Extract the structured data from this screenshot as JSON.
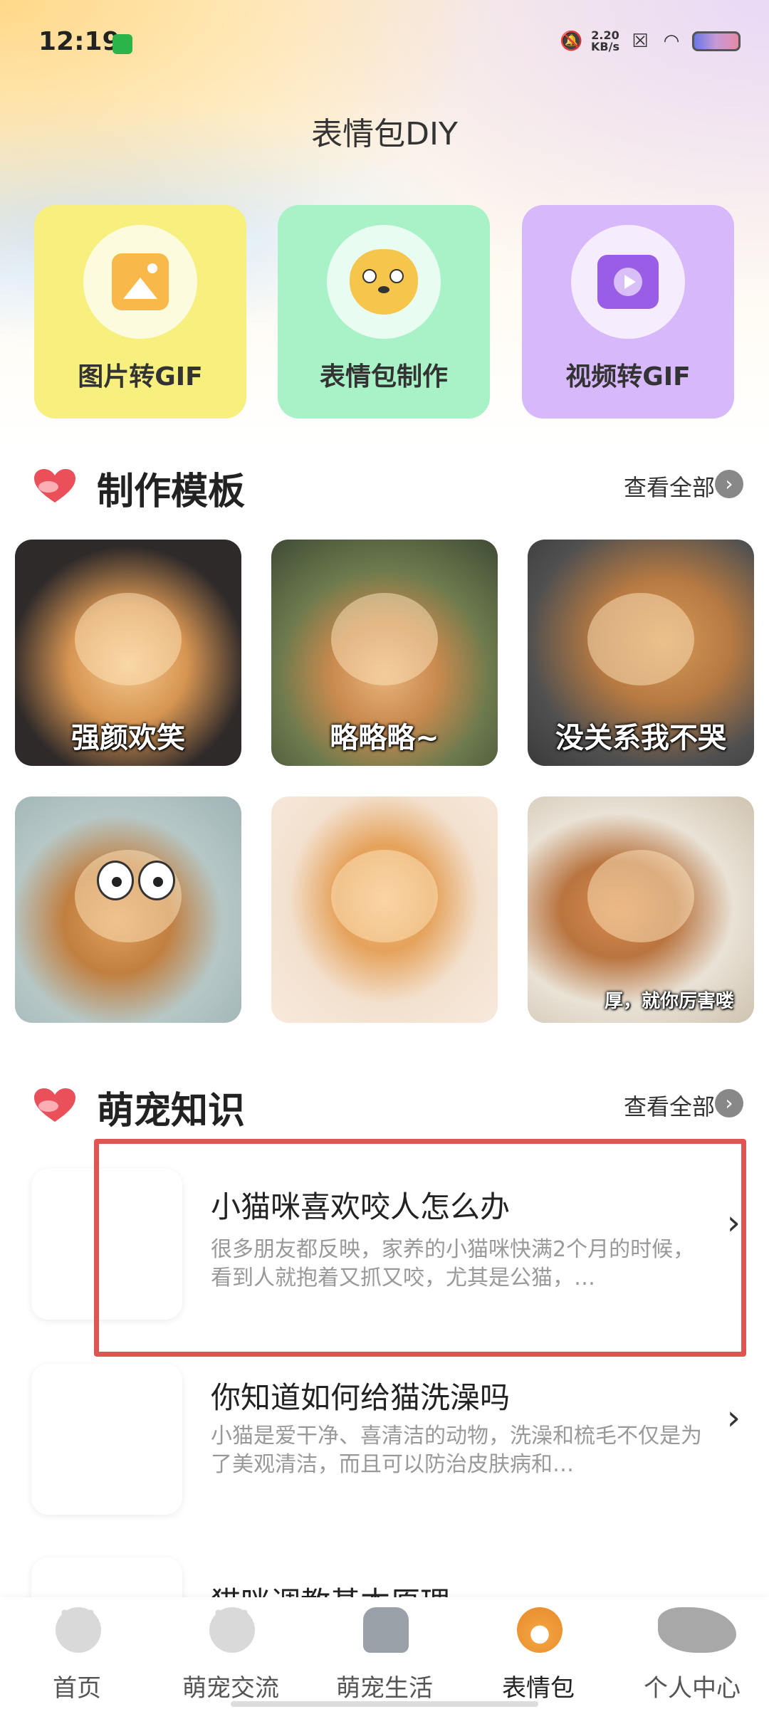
{
  "status": {
    "time": "12:19",
    "speed_value": "2.20",
    "speed_unit": "KB/s"
  },
  "page_title": "表情包DIY",
  "features": [
    {
      "label": "图片转GIF"
    },
    {
      "label": "表情包制作"
    },
    {
      "label": "视频转GIF"
    }
  ],
  "templates_section": {
    "title": "制作模板",
    "view_all": "查看全部"
  },
  "templates": [
    {
      "caption": "强颜欢笑"
    },
    {
      "caption": "略略略~"
    },
    {
      "caption": "没关系我不哭"
    },
    {
      "caption": ""
    },
    {
      "caption": ""
    },
    {
      "caption": "厚，就你厉害喽"
    }
  ],
  "knowledge_section": {
    "title": "萌宠知识",
    "view_all": "查看全部"
  },
  "articles": [
    {
      "title": "小猫咪喜欢咬人怎么办",
      "desc": "很多朋友都反映，家养的小猫咪快满2个月的时候，看到人就抱着又抓又咬，尤其是公猫，…"
    },
    {
      "title": "你知道如何给猫洗澡吗",
      "desc": "小猫是爱干净、喜清洁的动物，洗澡和梳毛不仅是为了美观清洁，而且可以防治皮肤病和…"
    },
    {
      "title": "猫咪调教基本原理",
      "desc": ""
    }
  ],
  "tabs": [
    {
      "label": "首页",
      "icon": "paw-icon"
    },
    {
      "label": "萌宠交流",
      "icon": "paw-icon"
    },
    {
      "label": "萌宠生活",
      "icon": "pet-bowl-icon"
    },
    {
      "label": "表情包",
      "icon": "shiba-icon",
      "active": true
    },
    {
      "label": "个人中心",
      "icon": "cat-icon"
    }
  ],
  "colors": {
    "accent_red": "#e05451",
    "card_yellow": "#f8f07e",
    "card_green": "#a9f2c8",
    "card_purple": "#d7b9fb"
  }
}
